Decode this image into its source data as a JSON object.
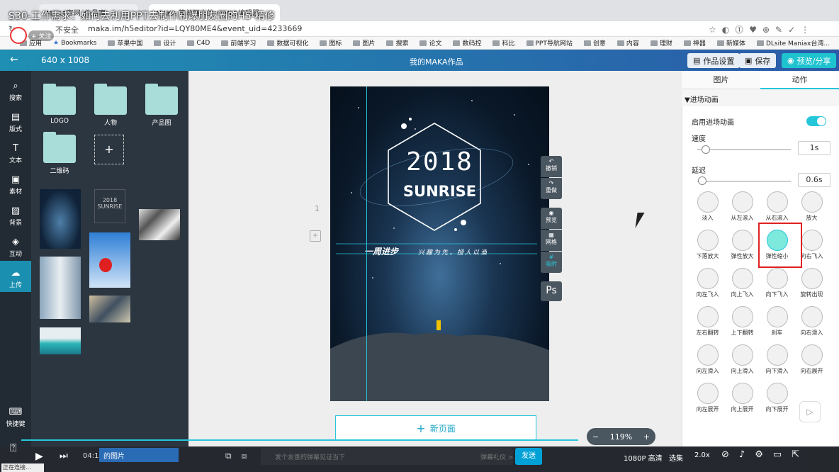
{
  "video": {
    "title": "S30-工作需求：如何去利用PPT去制作刷爆朋友圈的H5-精修",
    "follow": "+ 关注"
  },
  "browser": {
    "tabs": [
      "MAKA官网_作品库",
      "MAKA 简单强大的HTML5编辑器"
    ],
    "insecure": "不安全",
    "url": "maka.im/h5editor?id=LQY80ME4&event_uid=4233669",
    "bookmarks": [
      "应用",
      "Bookmarks",
      "苹果中国",
      "设计",
      "C4D",
      "前端学习",
      "数据可视化",
      "图标",
      "图片",
      "搜索",
      "论文",
      "数码控",
      "科比",
      "PPT导航网站",
      "创意",
      "内容",
      "理财",
      "神器",
      "新媒体",
      "DLsite Maniax台湾..."
    ]
  },
  "header": {
    "size": "640 x 1008",
    "title": "我的MAKA作品",
    "settings": "作品设置",
    "save": "保存",
    "preview": "预览/分享"
  },
  "leftnav": [
    {
      "icon": "search-icon",
      "glyph": "⌕",
      "label": "搜索"
    },
    {
      "icon": "layout-icon",
      "glyph": "▤",
      "label": "版式"
    },
    {
      "icon": "text-icon",
      "glyph": "T",
      "label": "文本"
    },
    {
      "icon": "image-icon",
      "glyph": "▣",
      "label": "素材"
    },
    {
      "icon": "background-icon",
      "glyph": "▨",
      "label": "背景"
    },
    {
      "icon": "interact-icon",
      "glyph": "◈",
      "label": "互动"
    },
    {
      "icon": "upload-icon",
      "glyph": "☁",
      "label": "上传"
    },
    {
      "icon": "keyboard-icon",
      "glyph": "⌨",
      "label": "快捷键"
    }
  ],
  "folders": [
    "LOGO",
    "人物",
    "产品图",
    "二维码"
  ],
  "canvas": {
    "page_number": "1",
    "year": "2018",
    "word": "SUNRISE",
    "banner_left": "一周进步",
    "banner_right": "兴趣为先，授人以渔"
  },
  "tools": [
    {
      "icon": "undo-icon",
      "glyph": "↶",
      "label": "撤销"
    },
    {
      "icon": "redo-icon",
      "glyph": "↷",
      "label": "重做"
    },
    {
      "icon": "eye-icon",
      "glyph": "◉",
      "label": "预览"
    },
    {
      "icon": "grid-icon",
      "glyph": "▦",
      "label": "网格"
    },
    {
      "icon": "snap-icon",
      "glyph": "#",
      "label": "吸附"
    },
    {
      "icon": "ps-icon",
      "glyph": "Ps",
      "label": ""
    }
  ],
  "newpage": "新页面",
  "zoom": {
    "minus": "−",
    "value": "119%",
    "plus": "+"
  },
  "rpanel": {
    "tabs": [
      "图片",
      "动作"
    ],
    "section": "▼进场动画",
    "enable_label": "启用进场动画",
    "speed_label": "速度",
    "speed_value": "1s",
    "delay_label": "延迟",
    "delay_value": "0.6s",
    "animations": [
      "淡入",
      "从左滚入",
      "从右滚入",
      "放大",
      "下落放大",
      "弹性放大",
      "弹性缩小",
      "向右飞入",
      "向左飞入",
      "向上飞入",
      "向下飞入",
      "旋转出现",
      "左右翻转",
      "上下翻转",
      "刹车",
      "向右滑入",
      "向左滑入",
      "向上滑入",
      "向下滑入",
      "向右展开",
      "向左展开",
      "向上展开",
      "向下展开"
    ],
    "selected": "弹性缩小"
  },
  "player": {
    "time": "04:1",
    "ad": "的图片",
    "danmaku_placeholder": "发个友善的弹幕见证当下",
    "etiquette": "弹幕礼仪 >",
    "send": "发送",
    "quality": "1080P 高清",
    "select": "选集",
    "speed": "2.0x"
  },
  "status": "正在连接..."
}
